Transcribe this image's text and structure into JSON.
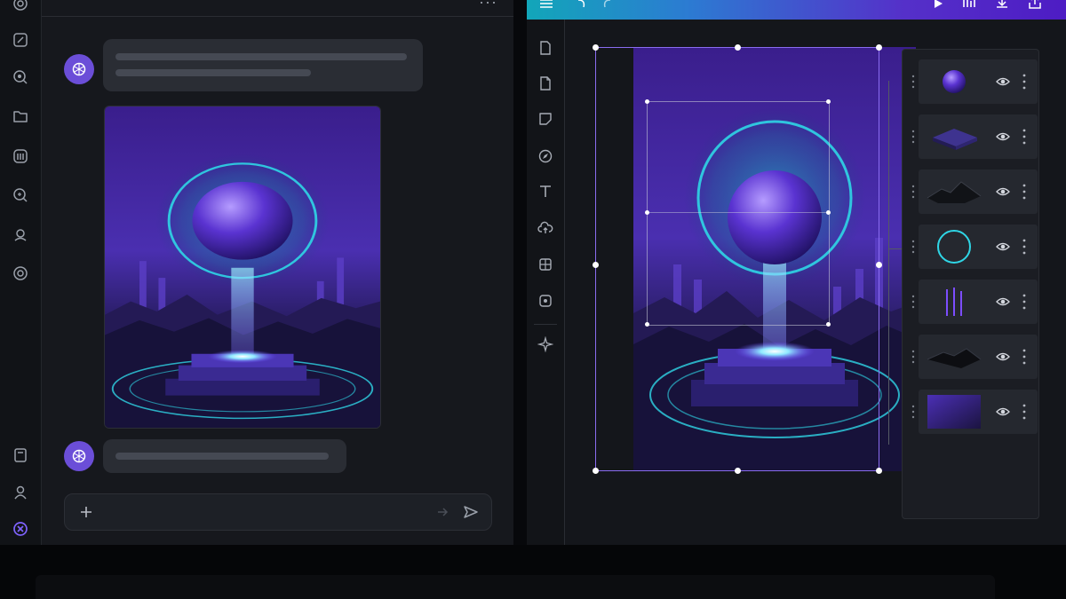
{
  "chat": {
    "sidebar_icons": [
      "logo-icon",
      "edit-icon",
      "search-icon",
      "folder-icon",
      "library-icon",
      "explore-icon",
      "upload-icon",
      "settings-icon",
      "notes-icon",
      "profile-icon",
      "close-circle-icon"
    ],
    "more_label": "···",
    "composer": {
      "placeholder": "",
      "add_icon": "plus-icon",
      "send_icon": "send-icon"
    }
  },
  "editor": {
    "toolbar_icons": [
      "menu-icon",
      "undo-icon",
      "redo-icon",
      "play-icon",
      "waveform-icon",
      "download-icon",
      "share-icon"
    ],
    "tool_icons": [
      "file-icon",
      "document-icon",
      "sticker-icon",
      "compass-icon",
      "text-icon",
      "cloud-upload-icon",
      "grid-icon",
      "media-icon",
      "sparkle-icon"
    ],
    "layers": [
      {
        "name": "sphere",
        "thumb": "sphere-thumb"
      },
      {
        "name": "platform",
        "thumb": "platform-thumb"
      },
      {
        "name": "mountains",
        "thumb": "mountains-thumb"
      },
      {
        "name": "ring",
        "thumb": "ring-thumb"
      },
      {
        "name": "light-beams",
        "thumb": "beams-thumb"
      },
      {
        "name": "terrain",
        "thumb": "terrain-thumb"
      },
      {
        "name": "background",
        "thumb": "background-thumb"
      }
    ]
  },
  "colors": {
    "accent_purple": "#6b4ed8",
    "cyan_glow": "#2fd6e6",
    "selection": "#8a6cf0",
    "bg_dark": "#16181d"
  }
}
